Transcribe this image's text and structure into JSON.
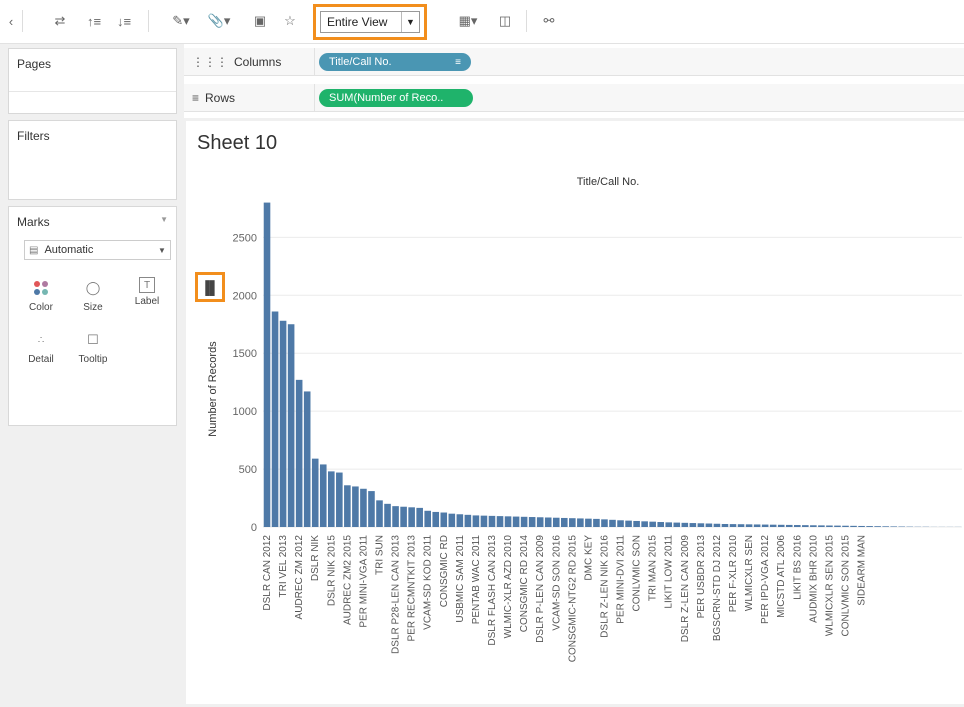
{
  "toolbar": {
    "view_select": "Entire View"
  },
  "panes": {
    "pages": "Pages",
    "filters": "Filters",
    "marks": "Marks",
    "marks_type": "Automatic",
    "mark_buttons": [
      "Color",
      "Size",
      "Label",
      "Detail",
      "Tooltip"
    ]
  },
  "shelves": {
    "columns_label": "Columns",
    "columns_pill": "Title/Call No.",
    "rows_label": "Rows",
    "rows_pill": "SUM(Number of Reco.."
  },
  "sheet_title": "Sheet 10",
  "chart_data": {
    "type": "bar",
    "title": "",
    "xlabel": "Title/Call No.",
    "ylabel": "Number of Records",
    "ylim": [
      0,
      2900
    ],
    "yticks": [
      0,
      500,
      1000,
      1500,
      2000,
      2500
    ],
    "grid": true,
    "bar_color": "#4e79a7",
    "categories": [
      "DSLR CAN 2012",
      "",
      "TRI VEL 2013",
      "",
      "AUDREC ZM 2012",
      "",
      "DSLR NIK",
      "",
      "DSLR NIK 2015",
      "",
      "AUDREC ZM2 2015",
      "",
      "PER MINI-VGA 2011",
      "",
      "TRI SUN",
      "",
      "DSLR P28-LEN CAN 2013",
      "",
      "PER RECMNTKIT 2013",
      "",
      "VCAM-SD KOD 2011",
      "",
      "CONSGMIC RD",
      "",
      "USBMIC SAM 2011",
      "",
      "PENTAB WAC 2011",
      "",
      "DSLR FLASH CAN 2013",
      "",
      "WLMIC-XLR AZD 2010",
      "",
      "CONSGMIC RD 2014",
      "",
      "DSLR P-LEN CAN 2009",
      "",
      "VCAM-SD SON 2016",
      "",
      "CONSGMIC-NTG2 RD 2015",
      "",
      "DMC KEY",
      "",
      "DSLR Z-LEN NIK 2016",
      "",
      "PER MINI-DVI 2011",
      "",
      "CONLVMIC SON",
      "",
      "TRI MAN 2015",
      "",
      "LIKIT LOW 2011",
      "",
      "DSLR Z-LEN CAN 2009",
      "",
      "PER USBDR 2013",
      "",
      "BGSCRN-STD DJ 2012",
      "",
      "PER F-XLR 2010",
      "",
      "WLMICXLR SEN",
      "",
      "PER IPD-VGA 2012",
      "",
      "MICSTD ATL 2006",
      "",
      "LIKIT BS 2016",
      "",
      "AUDMIX BHR 2010",
      "",
      "WLMICXLR SEN 2015",
      "",
      "CONLVMIC SON 2015",
      "",
      "SIDEARM MAN"
    ],
    "values": [
      2800,
      1860,
      1780,
      1750,
      1270,
      1170,
      590,
      540,
      480,
      470,
      360,
      350,
      330,
      310,
      230,
      200,
      180,
      175,
      170,
      165,
      140,
      130,
      125,
      115,
      110,
      105,
      100,
      98,
      96,
      94,
      92,
      90,
      88,
      86,
      84,
      82,
      80,
      78,
      76,
      74,
      72,
      70,
      66,
      62,
      58,
      55,
      52,
      49,
      46,
      43,
      40,
      38,
      36,
      34,
      32,
      30,
      28,
      26,
      25,
      24,
      23,
      22,
      21,
      20,
      19,
      18,
      17,
      16,
      15,
      14,
      13,
      12,
      11,
      10,
      9,
      8,
      7,
      6,
      5,
      4,
      3,
      2,
      2,
      1,
      1,
      1,
      1
    ]
  }
}
